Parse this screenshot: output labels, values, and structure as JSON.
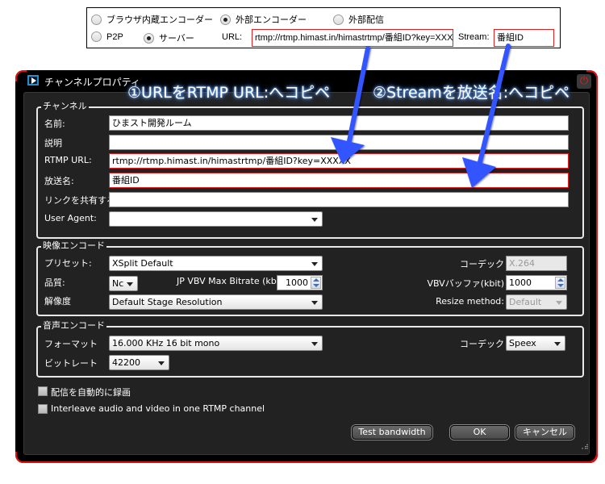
{
  "web_panel": {
    "radios_row1": [
      {
        "label": "ブラウザ内蔵エンコーダー",
        "checked": false
      },
      {
        "label": "外部エンコーダー",
        "checked": true
      },
      {
        "label": "外部配信",
        "checked": false
      }
    ],
    "radios_row2": [
      {
        "label": "P2P",
        "checked": false
      },
      {
        "label": "サーバー",
        "checked": true
      }
    ],
    "url_label": "URL:",
    "url_value": "rtmp://rtmp.himast.in/himastrtmp/番組ID?key=XXX",
    "stream_label": "Stream:",
    "stream_value": "番組ID"
  },
  "dialog": {
    "title": "チャンネルプロパティ",
    "power_icon": "⏻",
    "channel_group": {
      "title": "チャンネル",
      "name_label": "名前:",
      "name_value": "ひまスト開発ルーム",
      "description_label": "説明",
      "description_value": "",
      "rtmp_url_label": "RTMP URL:",
      "rtmp_url_value": "rtmp://rtmp.himast.in/himastrtmp/番組ID?key=XXXXX",
      "stream_name_label": "放送名:",
      "stream_name_value": "番組ID",
      "share_link_label": "リンクを共有する:",
      "share_link_value": "",
      "user_agent_label": "User Agent:",
      "user_agent_value": ""
    },
    "video_group": {
      "title": "映像エンコード",
      "preset_label": "プリセット:",
      "preset_value": "XSplit Default",
      "quality_label": "品質:",
      "quality_value": "Nc",
      "max_bitrate_label": "JP VBV Max Bitrate (kb",
      "max_bitrate_value": "1000",
      "resolution_label": "解像度",
      "resolution_value": "Default Stage Resolution",
      "codec_label": "コーデック",
      "codec_value": "X.264",
      "vbv_buffer_label": "VBVバッファ(kbit)",
      "vbv_buffer_value": "1000",
      "resize_method_label": "Resize method:",
      "resize_method_value": "Default"
    },
    "audio_group": {
      "title": "音声エンコード",
      "format_label": "フォーマット",
      "format_value": "16.000 KHz 16 bit mono",
      "bitrate_label": "ビットレート",
      "bitrate_value": "42200",
      "codec_label": "コーデック",
      "codec_value": "Speex"
    },
    "auto_record": {
      "label": "配信を自動的に録画",
      "checked": false
    },
    "interleave": {
      "label": "Interleave audio and video in one RTMP channel",
      "checked": false
    },
    "buttons": {
      "test_bandwidth": "Test bandwidth",
      "ok": "OK",
      "cancel": "キャンセル"
    }
  },
  "annotations": {
    "step1": "①URLをRTMP URL:へコピペ",
    "step2": "②Streamを放送名:へコピペ",
    "arrow_color": "#3355ff"
  }
}
